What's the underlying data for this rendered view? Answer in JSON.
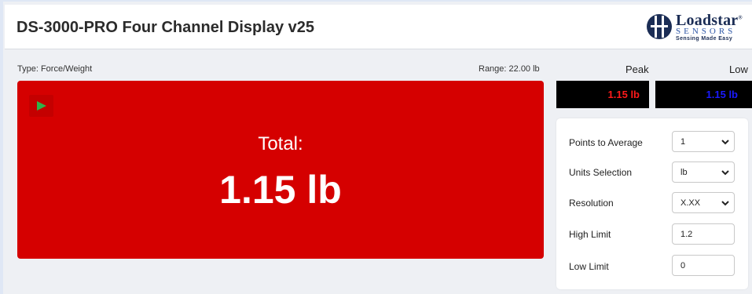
{
  "header": {
    "title": "DS-3000-PRO Four Channel Display v25",
    "logo": {
      "name": "Loadstar",
      "registered": "®",
      "sub": "SENSORS",
      "tagline": "Sensing Made Easy"
    }
  },
  "meta": {
    "type_label": "Type:  Force/Weight",
    "range_label": "Range:  22.00 lb"
  },
  "display": {
    "background_color": "#d50000",
    "play_icon": "play-icon",
    "total_label": "Total:",
    "total_value": "1.15 lb"
  },
  "readouts": {
    "peak_label": "Peak",
    "peak_value": "1.15 lb",
    "peak_color": "#ff1a1a",
    "low_label": "Low",
    "low_value": "1.15 lb",
    "low_color": "#1a1aff"
  },
  "settings": {
    "points_to_average": {
      "label": "Points to Average",
      "value": "1"
    },
    "units_selection": {
      "label": "Units Selection",
      "value": "lb"
    },
    "resolution": {
      "label": "Resolution",
      "value": "X.XX"
    },
    "high_limit": {
      "label": "High Limit",
      "value": "1.2"
    },
    "low_limit": {
      "label": "Low Limit",
      "value": "0"
    }
  }
}
